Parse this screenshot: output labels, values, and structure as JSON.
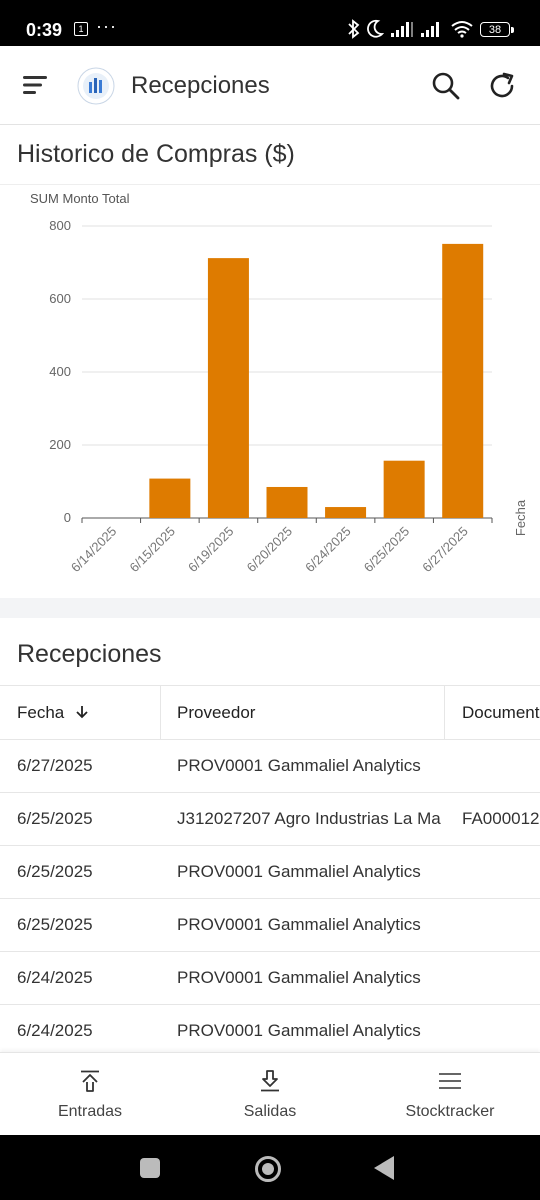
{
  "status_bar": {
    "time": "0:39",
    "notification_badge": "1",
    "more_dots": "···",
    "battery": "38"
  },
  "app_bar": {
    "title": "Recepciones",
    "icons": [
      "menu-icon",
      "brand-logo",
      "search-icon",
      "refresh-icon"
    ]
  },
  "chart_section": {
    "title": "Historico de Compras ($)"
  },
  "chart_data": {
    "type": "bar",
    "ylabel": "SUM Monto Total",
    "xlabel": "Fecha",
    "categories": [
      "6/14/2025",
      "6/15/2025",
      "6/19/2025",
      "6/20/2025",
      "6/24/2025",
      "6/25/2025",
      "6/27/2025"
    ],
    "values": [
      0,
      108,
      712,
      85,
      30,
      157,
      751
    ],
    "yticks": [
      0,
      200,
      400,
      600,
      800
    ],
    "ylim": [
      0,
      800
    ],
    "grid": true,
    "bar_color": "#de7b00"
  },
  "table_section": {
    "title": "Recepciones",
    "columns": [
      "Fecha",
      "Proveedor",
      "Documento"
    ],
    "rows": [
      {
        "fecha": "6/27/2025",
        "proveedor": "PROV0001 Gammaliel Analytics",
        "documento": ""
      },
      {
        "fecha": "6/25/2025",
        "proveedor": "J312027207 Agro Industrias La Ma",
        "documento": "FA000012"
      },
      {
        "fecha": "6/25/2025",
        "proveedor": "PROV0001 Gammaliel Analytics",
        "documento": ""
      },
      {
        "fecha": "6/25/2025",
        "proveedor": "PROV0001 Gammaliel Analytics",
        "documento": ""
      },
      {
        "fecha": "6/24/2025",
        "proveedor": "PROV0001 Gammaliel Analytics",
        "documento": ""
      },
      {
        "fecha": "6/24/2025",
        "proveedor": "PROV0001 Gammaliel Analytics",
        "documento": ""
      }
    ]
  },
  "bottom_nav": {
    "items": [
      {
        "label": "Entradas",
        "icon": "upload-icon"
      },
      {
        "label": "Salidas",
        "icon": "download-icon"
      },
      {
        "label": "Stocktracker",
        "icon": "menu-lines-icon"
      }
    ]
  },
  "colors": {
    "accent": "#de7b00",
    "text": "#333333",
    "divider": "#e6e6e6"
  }
}
